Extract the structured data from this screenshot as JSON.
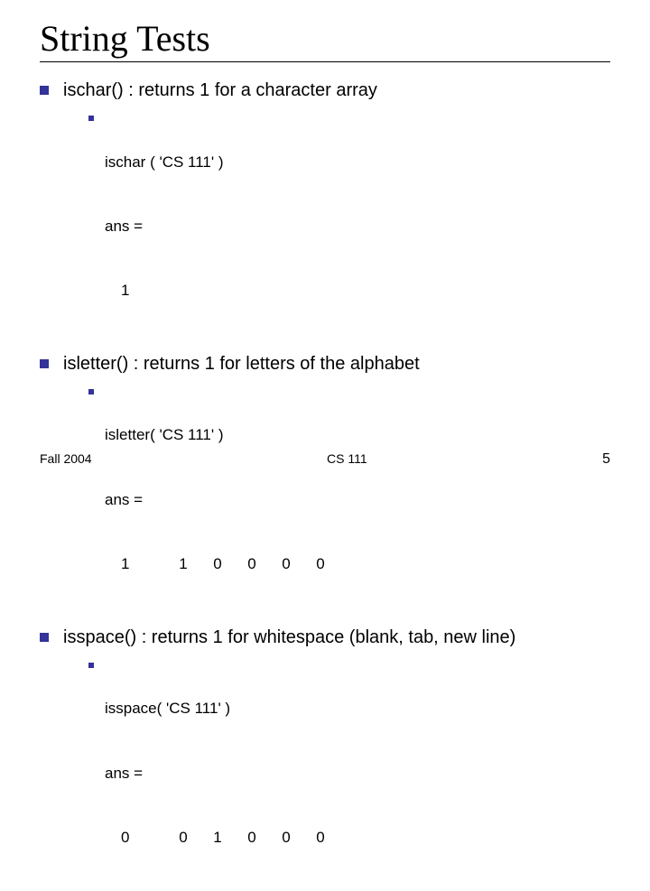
{
  "title": "String Tests",
  "items": [
    {
      "heading": "ischar() : returns 1 for a character array",
      "call": "ischar ( 'CS 111' )",
      "ans_label": "ans =",
      "result": [
        "1"
      ]
    },
    {
      "heading": "isletter() : returns 1 for letters of the alphabet",
      "call": "isletter( 'CS 111' )",
      "ans_label": "ans =",
      "result": [
        "1",
        "1",
        "0",
        "0",
        "0",
        "0"
      ]
    },
    {
      "heading": "isspace() : returns 1 for whitespace (blank, tab, new line)",
      "call": "isspace( 'CS 111' )",
      "ans_label": "ans =",
      "result": [
        "0",
        "0",
        "1",
        "0",
        "0",
        "0"
      ]
    }
  ],
  "footer": {
    "left": "Fall 2004",
    "center": "CS 111",
    "right": "5"
  }
}
